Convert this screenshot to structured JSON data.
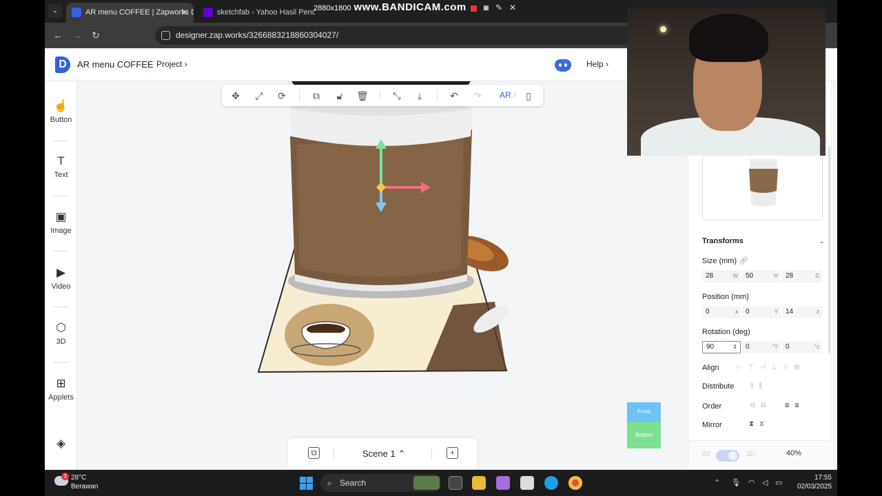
{
  "browser": {
    "tabs": [
      {
        "title": "AR menu COFFEE | Zapworks De",
        "active": true
      },
      {
        "title": "sketchfab - Yahoo Hasil Pencari",
        "active": false
      }
    ],
    "recorder": {
      "resolution": "2880x1800",
      "brand": "www.BANDICAM.com"
    },
    "url": "designer.zap.works/3266883218860304027/"
  },
  "app": {
    "title": "AR menu COFFEE",
    "project_menu": "Project",
    "help": "Help",
    "discord_icon": "discord-icon"
  },
  "leftbar": {
    "items": [
      {
        "label": "Button",
        "icon": "hand-icon"
      },
      {
        "label": "Text",
        "icon": "text-icon"
      },
      {
        "label": "Image",
        "icon": "image-icon"
      },
      {
        "label": "Video",
        "icon": "video-icon"
      },
      {
        "label": "3D",
        "icon": "cube-icon"
      },
      {
        "label": "Applets",
        "icon": "applets-icon"
      }
    ],
    "layers_icon": "layers-icon"
  },
  "toolbar": {
    "tools": [
      "move-icon",
      "scale-icon",
      "rotate-icon",
      "duplicate-icon",
      "unlock-icon",
      "delete-icon",
      "collapse-icon",
      "drop-to-floor-icon",
      "undo-icon",
      "redo-icon",
      "phone-icon"
    ],
    "ar_label": "AR"
  },
  "scene": {
    "label": "Scene 1"
  },
  "viewcube": {
    "front": "Front",
    "bottom": "Bottom"
  },
  "panel": {
    "transforms_title": "Transforms",
    "size": {
      "label": "Size (mm)",
      "w": "28",
      "w_unit": "W",
      "h": "50",
      "h_unit": "H",
      "d": "28",
      "d_unit": "D"
    },
    "position": {
      "label": "Position (mm)",
      "x": "0",
      "x_unit": "x",
      "y": "0",
      "y_unit": "Y",
      "z": "14",
      "z_unit": "z"
    },
    "rotation": {
      "label": "Rotation (deg)",
      "x": "90",
      "y": "0",
      "y_unit": "°Y",
      "z": "0",
      "z_unit": "°z"
    },
    "align": "Align",
    "distribute": "Distribute",
    "order": "Order",
    "mirror": "Mirror",
    "mode_2d": "2D",
    "mode_3d": "3D",
    "zoom": "40%"
  },
  "taskbar": {
    "weather_temp": "28°C",
    "weather_desc": "Berawan",
    "weather_badge": "3",
    "search": "Search",
    "time": "17:55",
    "date": "02/03/2025"
  },
  "colors": {
    "accent": "#3460e6",
    "viewcube_front": "#6ec1f4",
    "viewcube_bottom": "#7ddf92"
  }
}
